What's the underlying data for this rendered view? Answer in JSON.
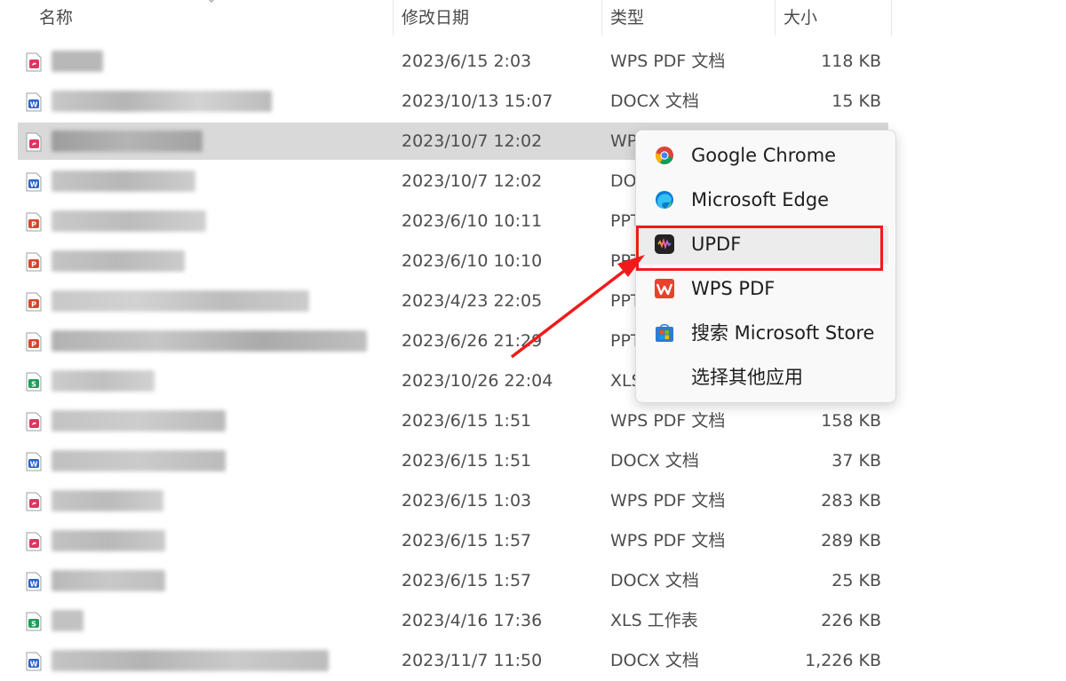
{
  "header": {
    "name": "名称",
    "modified": "修改日期",
    "type": "类型",
    "size": "大小"
  },
  "rows": [
    {
      "icon": "wps-pdf-file-icon",
      "date": "2023/6/15 2:03",
      "type": "WPS PDF 文档",
      "size": "118 KB"
    },
    {
      "icon": "docx-file-icon",
      "date": "2023/10/13 15:07",
      "type": "DOCX 文档",
      "size": "15 KB"
    },
    {
      "icon": "wps-pdf-file-icon",
      "date": "2023/10/7 12:02",
      "type": "WPS PDF 文档",
      "size": "",
      "selected": true
    },
    {
      "icon": "docx-file-icon",
      "date": "2023/10/7 12:02",
      "type": "DOCX 文档",
      "size": ""
    },
    {
      "icon": "ppt-file-icon",
      "date": "2023/6/10 10:11",
      "type": "PPT",
      "size": ""
    },
    {
      "icon": "ppt-file-icon",
      "date": "2023/6/10 10:10",
      "type": "PPT",
      "size": ""
    },
    {
      "icon": "ppt-file-icon",
      "date": "2023/4/23 22:05",
      "type": "PPT",
      "size": ""
    },
    {
      "icon": "ppt-file-icon",
      "date": "2023/6/26 21:29",
      "type": "PPT",
      "size": ""
    },
    {
      "icon": "xls-file-icon",
      "date": "2023/10/26 22:04",
      "type": "XLS",
      "size": ""
    },
    {
      "icon": "wps-pdf-file-icon",
      "date": "2023/6/15 1:51",
      "type": "WPS PDF 文档",
      "size": "158 KB"
    },
    {
      "icon": "docx-file-icon",
      "date": "2023/6/15 1:51",
      "type": "DOCX 文档",
      "size": "37 KB"
    },
    {
      "icon": "wps-pdf-file-icon",
      "date": "2023/6/15 1:03",
      "type": "WPS PDF 文档",
      "size": "283 KB"
    },
    {
      "icon": "wps-pdf-file-icon",
      "date": "2023/6/15 1:57",
      "type": "WPS PDF 文档",
      "size": "289 KB"
    },
    {
      "icon": "docx-file-icon",
      "date": "2023/6/15 1:57",
      "type": "DOCX 文档",
      "size": "25 KB"
    },
    {
      "icon": "xls-file-icon",
      "date": "2023/4/16 17:36",
      "type": "XLS 工作表",
      "size": "226 KB"
    },
    {
      "icon": "docx-file-icon",
      "date": "2023/11/7 11:50",
      "type": "DOCX 文档",
      "size": "1,226 KB"
    }
  ],
  "context_menu": {
    "items": [
      {
        "label": "Google Chrome",
        "icon": "chrome-icon"
      },
      {
        "label": "Microsoft Edge",
        "icon": "edge-icon"
      },
      {
        "label": "UPDF",
        "icon": "updf-icon",
        "highlighted": true
      },
      {
        "label": "WPS PDF",
        "icon": "wps-pdf-icon"
      },
      {
        "label": "搜索 Microsoft Store",
        "icon": "microsoft-store-icon"
      },
      {
        "label": "选择其他应用",
        "icon": ""
      }
    ]
  },
  "annotation": {
    "color": "#f11a1a"
  }
}
